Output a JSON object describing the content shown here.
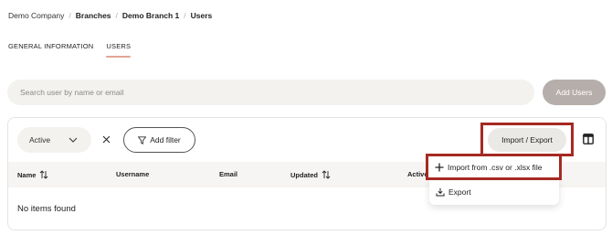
{
  "breadcrumb": {
    "items": [
      "Demo Company",
      "Branches",
      "Demo Branch 1",
      "Users"
    ],
    "separator": "/"
  },
  "tabs": [
    {
      "label": "GENERAL INFORMATION",
      "active": false
    },
    {
      "label": "USERS",
      "active": true
    }
  ],
  "search": {
    "placeholder": "Search user by name or email",
    "value": ""
  },
  "add_users_label": "Add Users",
  "filters": {
    "status_value": "Active",
    "add_filter_label": "Add filter"
  },
  "import_export_label": "Import / Export",
  "table": {
    "columns": [
      "Name",
      "Username",
      "Email",
      "Updated",
      "Active"
    ],
    "empty_text": "No items found"
  },
  "menu": {
    "import_label": "Import from .csv or .xlsx file",
    "export_label": "Export"
  },
  "colors": {
    "highlight_border": "#a52a23",
    "tab_underline": "#e3a694",
    "add_users_bg": "#b6aeaa"
  },
  "icons": [
    "chevron-down-icon",
    "close-icon",
    "filter-icon",
    "sort-icon",
    "columns-icon",
    "plus-icon",
    "download-icon"
  ]
}
